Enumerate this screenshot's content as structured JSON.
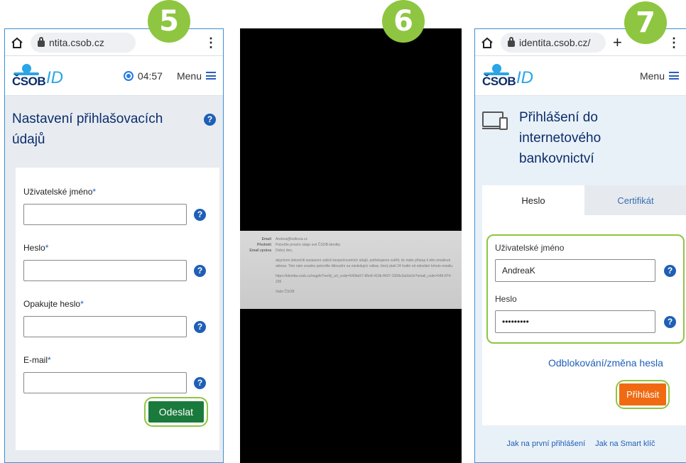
{
  "steps": [
    "5",
    "6",
    "7"
  ],
  "colors": {
    "brand_blue": "#0b2d6b",
    "accent_blue": "#2aa5e6",
    "highlight_green": "#8ec641",
    "submit_green": "#1a7a3c",
    "login_orange": "#f06a12"
  },
  "panel5": {
    "url": "ntita.csob.cz",
    "logo_text": "ČSOB",
    "logo_id": "ID",
    "timer": "04:57",
    "menu": "Menu",
    "title_line1": "Nastavení přihlašovacích",
    "title_line2": "údajů",
    "help": "?",
    "fields": [
      {
        "label": "Uživatelské jméno",
        "req": "*"
      },
      {
        "label": "Heslo",
        "req": "*"
      },
      {
        "label": "Opakujte heslo",
        "req": "*"
      },
      {
        "label": "E-mail",
        "req": "*"
      }
    ],
    "submit": "Odeslat"
  },
  "panel6": {
    "rows": [
      {
        "k": "Email",
        "v": "Andrea@kotkova.cz"
      },
      {
        "k": "Předmět",
        "v": "Potvrďte prosím údaje své ČSOB identity"
      },
      {
        "k": "Email zpráva",
        "v": "Dobrý den,"
      }
    ],
    "body1": "abychom dokončili nastavení vašich bezpečnostních údajů, potřebujeme ověřit, že máte přístup k této emailové adrese. Toto nám snadno potvrdíte kliknutím na následující odkaz, který platí 24 hodin od odeslání tohoto emailu.",
    "link": "https://identita.csob.cz/regpfs?verify_url_code=540be57-86e8-410b-8437-2308c3a0cb2e?email_code=049-874-236",
    "sign": "Vaše ČSOB"
  },
  "panel7": {
    "url": "identita.csob.cz/",
    "logo_text": "ČSOB",
    "logo_id": "ID",
    "menu": "Menu",
    "title_line1": "Přihlášení do",
    "title_line2": "internetového",
    "title_line3": "bankovnictví",
    "tab_password": "Heslo",
    "tab_certificate": "Certifikát",
    "username_label": "Uživatelské jméno",
    "username_value": "AndreaK",
    "password_label": "Heslo",
    "password_value": "•••••••••",
    "help": "?",
    "unlock_link": "Odblokování/změna hesla",
    "login_button": "Přihlásit",
    "link_first_login": "Jak na první přihlášení",
    "link_smart_key": "Jak na Smart klíč"
  }
}
